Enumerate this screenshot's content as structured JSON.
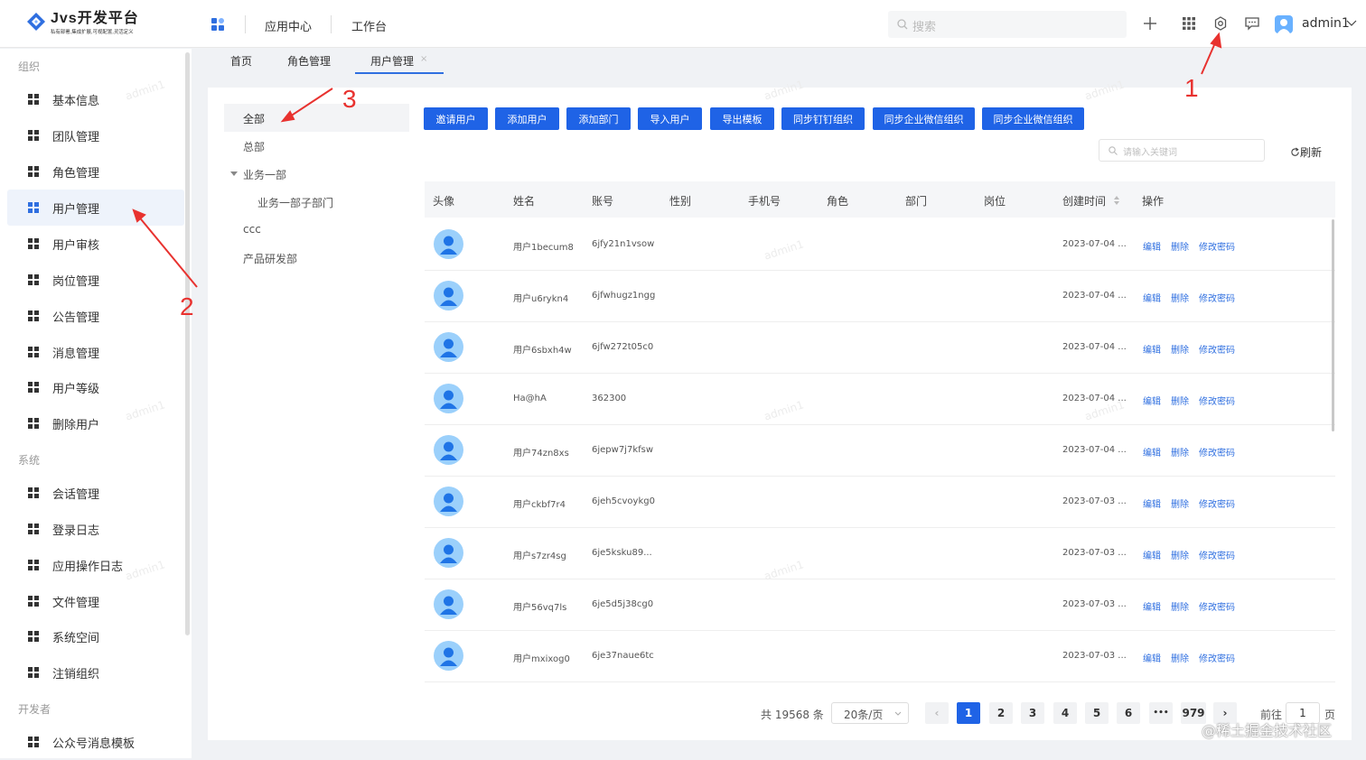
{
  "header": {
    "logo_title": "Jvs开发平台",
    "logo_subtitle": "私有部署,集成扩展,可视配置,灵活定义",
    "links": [
      "应用中心",
      "工作台"
    ],
    "search_placeholder": "搜索",
    "user_name": "admin1"
  },
  "sidebar": {
    "groups": [
      {
        "label": "组织",
        "items": [
          "基本信息",
          "团队管理",
          "角色管理",
          "用户管理",
          "用户审核",
          "岗位管理",
          "公告管理",
          "消息管理",
          "用户等级",
          "删除用户"
        ]
      },
      {
        "label": "系统",
        "items": [
          "会话管理",
          "登录日志",
          "应用操作日志",
          "文件管理",
          "系统空间",
          "注销组织"
        ]
      },
      {
        "label": "开发者",
        "items": [
          "公众号消息模板"
        ]
      }
    ],
    "active_item": "用户管理"
  },
  "tabs": [
    "首页",
    "角色管理",
    "用户管理"
  ],
  "tab_close": "×",
  "tree": [
    "全部",
    "总部",
    "业务一部",
    "业务一部子部门",
    "ccc",
    "产品研发部"
  ],
  "toolbar_buttons": [
    "邀请用户",
    "添加用户",
    "添加部门",
    "导入用户",
    "导出模板",
    "同步钉钉组织",
    "同步企业微信组织",
    "同步企业微信组织"
  ],
  "keyword_placeholder": "请输入关键词",
  "refresh_label": "刷新",
  "table": {
    "columns": [
      "头像",
      "姓名",
      "账号",
      "性别",
      "手机号",
      "角色",
      "部门",
      "岗位",
      "创建时间",
      "操作"
    ],
    "rows": [
      {
        "name": "用户1becum8",
        "account": "6jfy21n1vsow",
        "created": "2023-07-04 ..."
      },
      {
        "name": "用户u6rykn4",
        "account": "6jfwhugz1ngg",
        "created": "2023-07-04 ..."
      },
      {
        "name": "用户6sbxh4w",
        "account": "6jfw272t05c0",
        "created": "2023-07-04 ..."
      },
      {
        "name": "Ha@hA",
        "account": "362300",
        "created": "2023-07-04 ..."
      },
      {
        "name": "用户74zn8xs",
        "account": "6jepw7j7kfsw",
        "created": "2023-07-04 ..."
      },
      {
        "name": "用户ckbf7r4",
        "account": "6jeh5cvoykg0",
        "created": "2023-07-03 ..."
      },
      {
        "name": "用户s7zr4sg",
        "account": "6je5ksku89...",
        "created": "2023-07-03 ..."
      },
      {
        "name": "用户56vq7ls",
        "account": "6je5d5j38cg0",
        "created": "2023-07-03 ..."
      },
      {
        "name": "用户mxixog0",
        "account": "6je37naue6tc",
        "created": "2023-07-03 ..."
      }
    ],
    "actions": [
      "编辑",
      "删除",
      "修改密码"
    ]
  },
  "pagination": {
    "total": "共 19568 条",
    "page_size": "20条/页",
    "pages": [
      "1",
      "2",
      "3",
      "4",
      "5",
      "6",
      "•••",
      "979"
    ],
    "current": "1",
    "goto_label": "前往",
    "goto_value": "1",
    "page_unit": "页"
  },
  "annotations": [
    "1",
    "2",
    "3"
  ],
  "watermark": "admin1",
  "footer_mark": "@稀土掘金技术社区",
  "colors": {
    "primary": "#1f63e6",
    "annotation": "#e8322f",
    "avatar": "#9bd0fb"
  }
}
